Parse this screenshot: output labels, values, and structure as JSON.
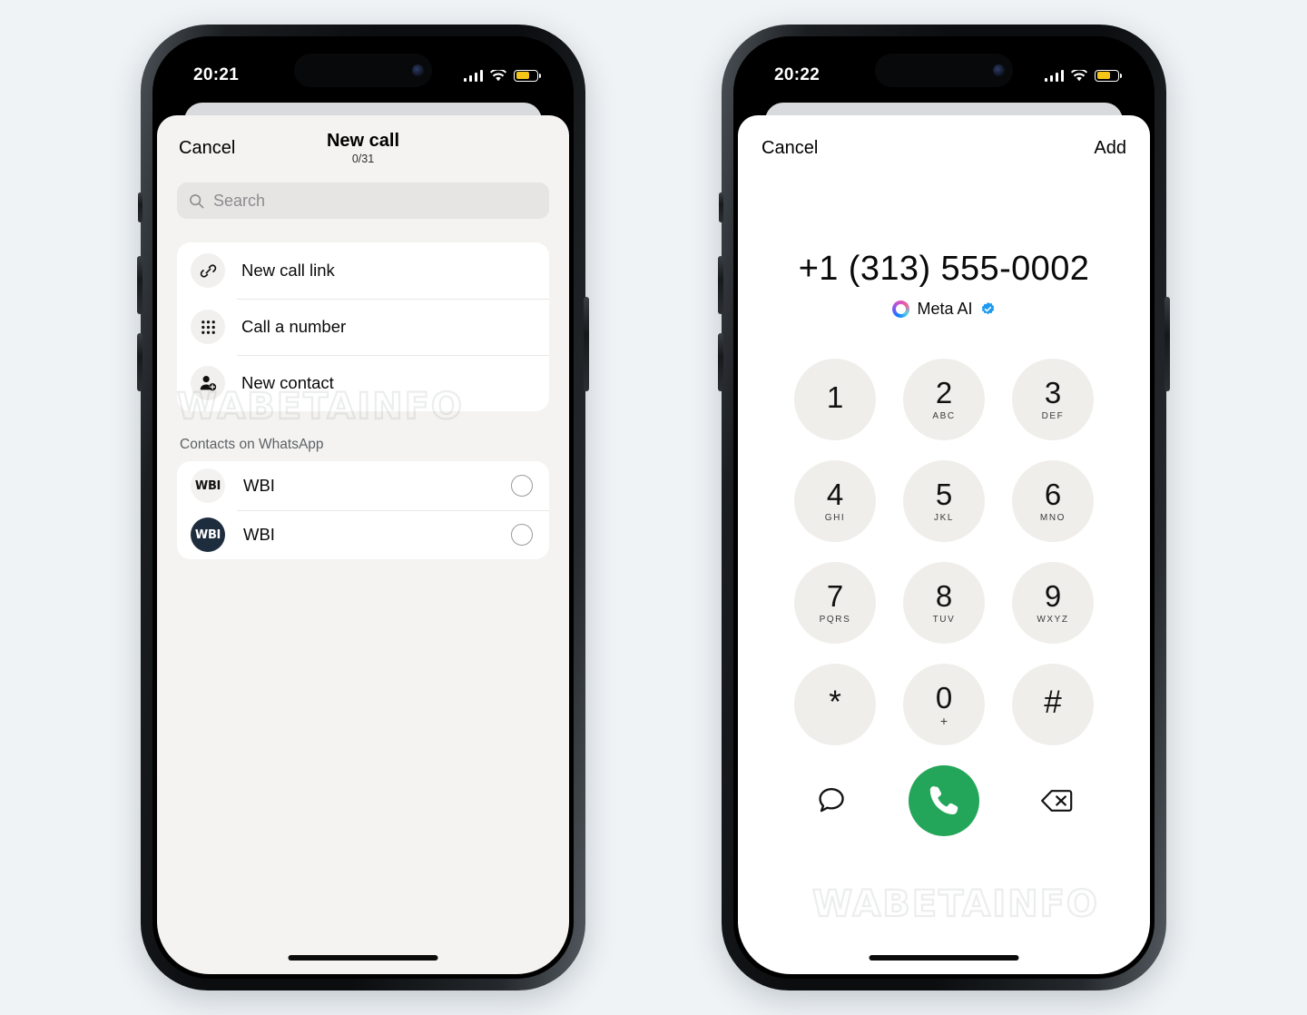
{
  "background_color": "#eff3f6",
  "watermark": "WABETAINFO",
  "phones": {
    "left": {
      "status_bar": {
        "time": "20:21",
        "signal_icon": "cellular-bars-icon",
        "wifi_icon": "wifi-icon",
        "battery_icon": "battery-icon",
        "battery_color": "#f5c518"
      },
      "header": {
        "cancel_label": "Cancel",
        "title": "New call",
        "counter": "0/31"
      },
      "search": {
        "placeholder": "Search",
        "icon": "search-icon"
      },
      "options": [
        {
          "label": "New call link",
          "icon": "link-icon"
        },
        {
          "label": "Call a number",
          "icon": "dialpad-icon"
        },
        {
          "label": "New contact",
          "icon": "person-add-icon"
        }
      ],
      "contacts_section_label": "Contacts on WhatsApp",
      "contacts": [
        {
          "name": "WBI",
          "avatar_text": "WBI",
          "avatar_style": "light",
          "selected": false
        },
        {
          "name": "WBI",
          "avatar_text": "WBI",
          "avatar_style": "dark",
          "selected": false
        }
      ]
    },
    "right": {
      "status_bar": {
        "time": "20:22",
        "signal_icon": "cellular-bars-icon",
        "wifi_icon": "wifi-icon",
        "battery_icon": "battery-icon",
        "battery_color": "#f5c518"
      },
      "header": {
        "cancel_label": "Cancel",
        "add_label": "Add"
      },
      "number": "+1 (313) 555-0002",
      "identity": {
        "name": "Meta AI",
        "logo_icon": "meta-ai-ring-icon",
        "verified_icon": "verified-badge-icon",
        "verified_color": "#1d9bf0"
      },
      "keypad": [
        [
          {
            "digit": "1",
            "letters": ""
          },
          {
            "digit": "2",
            "letters": "ABC"
          },
          {
            "digit": "3",
            "letters": "DEF"
          }
        ],
        [
          {
            "digit": "4",
            "letters": "GHI"
          },
          {
            "digit": "5",
            "letters": "JKL"
          },
          {
            "digit": "6",
            "letters": "MNO"
          }
        ],
        [
          {
            "digit": "7",
            "letters": "PQRS"
          },
          {
            "digit": "8",
            "letters": "TUV"
          },
          {
            "digit": "9",
            "letters": "WXYZ"
          }
        ],
        [
          {
            "digit": "*",
            "letters": ""
          },
          {
            "digit": "0",
            "letters": "+"
          },
          {
            "digit": "#",
            "letters": ""
          }
        ]
      ],
      "actions": {
        "message_icon": "chat-bubble-icon",
        "call_icon": "phone-call-icon",
        "call_button_color": "#24a65a",
        "backspace_icon": "backspace-icon"
      }
    }
  }
}
